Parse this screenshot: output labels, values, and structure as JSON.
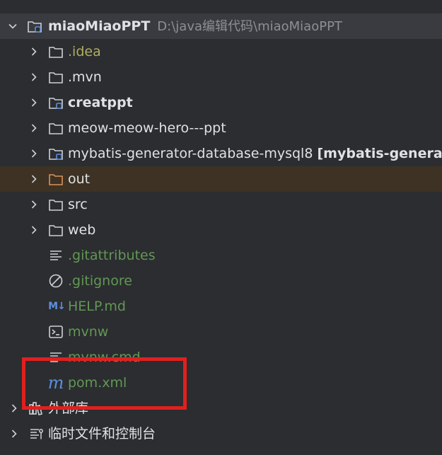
{
  "tree": {
    "root": {
      "name": "miaoMiaoPPT",
      "path": "D:\\java编辑代码\\miaoMiaoPPT"
    },
    "items": [
      {
        "label": "idea_name",
        "name": ".idea"
      },
      {
        "name": ".mvn"
      },
      {
        "name": "creatppt"
      },
      {
        "name": "meow-meow-hero---ppt"
      },
      {
        "name": "mybatis-generator-database-mysql8",
        "suffix": "[mybatis-generato"
      },
      {
        "name": "out"
      },
      {
        "name": "src"
      },
      {
        "name": "web"
      },
      {
        "name": ".gitattributes"
      },
      {
        "name": ".gitignore"
      },
      {
        "name": "HELP.md"
      },
      {
        "name": "mvnw"
      },
      {
        "name": "mvnw.cmd"
      },
      {
        "name": "pom.xml"
      }
    ],
    "external_libraries": "外部库",
    "scratches": "临时文件和控制台"
  },
  "colors": {
    "background": "#2b2d30",
    "root_selected": "#393b40",
    "excluded_row": "#3d3223",
    "highlight_box": "#e0201f",
    "text_default": "#dfe1e5",
    "text_yellow": "#b3ae60",
    "text_green": "#629755",
    "icon_blue": "#5d8fe0"
  },
  "icons": {
    "md": "M↓",
    "maven": "m"
  }
}
